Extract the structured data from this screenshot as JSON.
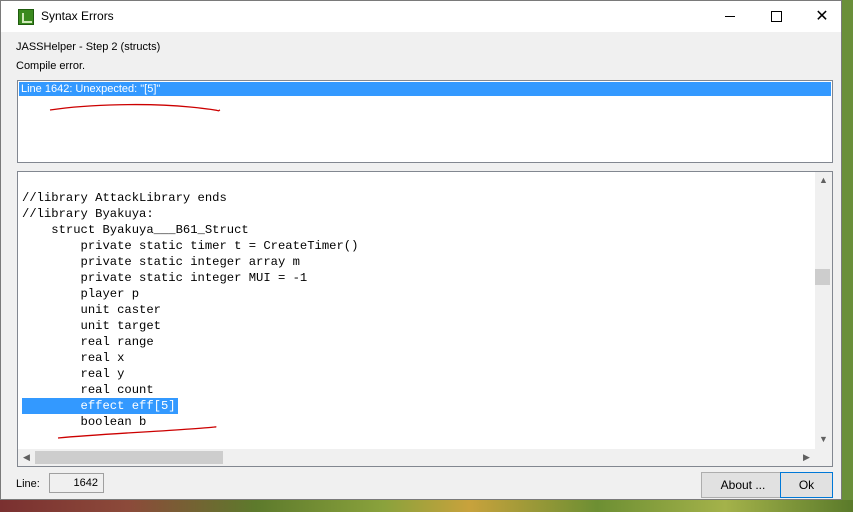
{
  "window": {
    "title": "Syntax Errors",
    "controls": {
      "minimize": "minimize",
      "maximize": "maximize",
      "close": "close"
    }
  },
  "header": {
    "step": "JASSHelper - Step 2 (structs)",
    "status": "Compile error."
  },
  "errors": [
    {
      "text": "Line 1642: Unexpected: \"[5]\""
    }
  ],
  "code_lines": [
    "//library AttackLibrary ends",
    "//library Byakuya:",
    "    struct Byakuya___B61_Struct",
    "        private static timer t = CreateTimer()",
    "        private static integer array m",
    "        private static integer MUI = -1",
    "        player p",
    "        unit caster",
    "        unit target",
    "        real range",
    "        real x",
    "        real y",
    "        real count",
    "        effect eff[5]",
    "        boolean b"
  ],
  "highlighted_line_index": 13,
  "footer": {
    "line_label": "Line:",
    "line_value": "1642",
    "about_label": "About ...",
    "ok_label": "Ok"
  },
  "colors": {
    "selection": "#3399ff",
    "annotation": "#cc0000"
  }
}
